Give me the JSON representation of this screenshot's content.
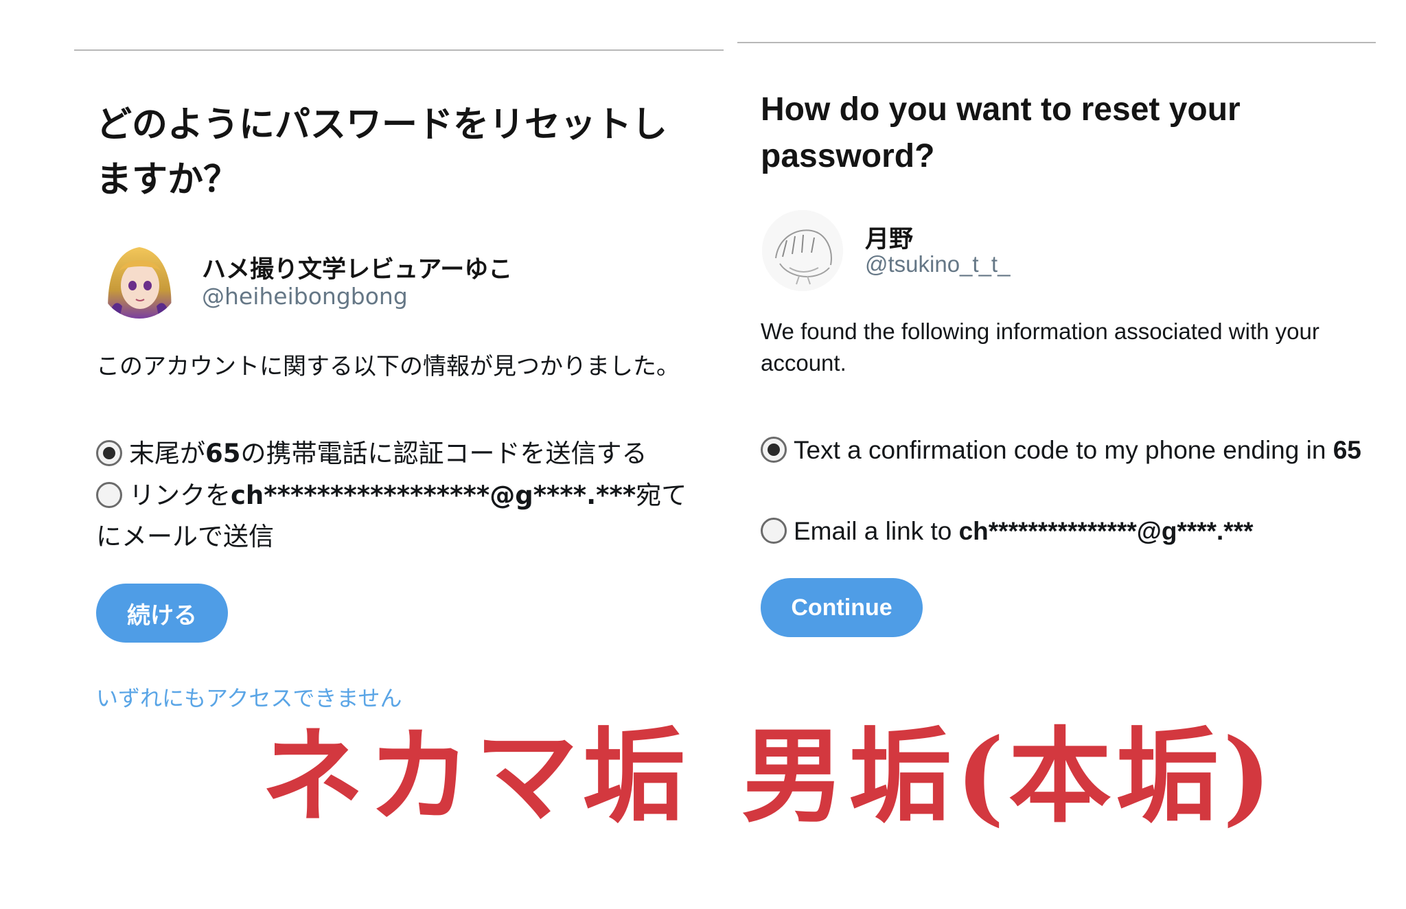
{
  "jp": {
    "title": "どのようにパスワードをリセットしますか？",
    "account_name": "ハメ撮り文学レビュアーゆこ",
    "account_handle": "@heiheibongbong",
    "description": "このアカウントに関する以下の情報が見つかりました。",
    "option1_pre": "末尾が",
    "option1_bold": "65",
    "option1_post": "の携帯電話に認証コードを送信する",
    "option2_pre": "リンクを",
    "option2_bold": "ch*****************@g****.***",
    "option2_post": "宛てにメールで送信",
    "continue_label": "続ける",
    "no_access_label": "いずれにもアクセスできません",
    "caption": "ネカマ垢"
  },
  "en": {
    "title": "How do you want to reset your password?",
    "account_name": "月野",
    "account_handle": "@tsukino_t_t_",
    "description": "We found the following information associated with your account.",
    "option1_pre": "Text a confirmation code to my phone ending in ",
    "option1_bold": "65",
    "option2_pre": "Email a link to ",
    "option2_bold": "ch***************@g****.***",
    "continue_label": "Continue",
    "caption": "男垢(本垢)"
  },
  "colors": {
    "button": "#4f9de6",
    "link": "#5aa5e6",
    "caption": "#d3383f",
    "handle": "#657786"
  },
  "icons": {
    "jp_avatar": "anime-avatar-icon",
    "en_avatar": "sketch-avatar-icon",
    "radio_selected": "radio-selected-icon",
    "radio_unselected": "radio-unselected-icon"
  }
}
